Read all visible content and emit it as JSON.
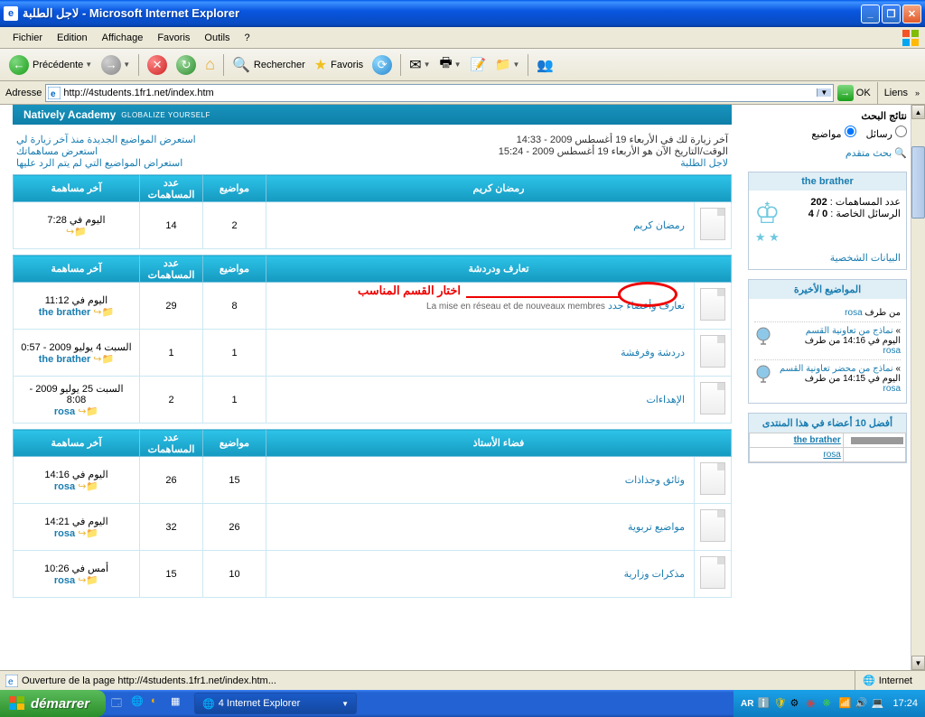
{
  "window": {
    "title": "لاجل الطلبة - Microsoft Internet Explorer"
  },
  "menu": {
    "file": "Fichier",
    "edit": "Edition",
    "view": "Affichage",
    "favorites": "Favoris",
    "tools": "Outils",
    "help": "?"
  },
  "toolbar": {
    "back": "Précédente",
    "search": "Rechercher",
    "favorites": "Favoris"
  },
  "address": {
    "label": "Adresse",
    "url": "http://4students.1fr1.net/index.htm",
    "ok": "OK",
    "links": "Liens"
  },
  "banner": {
    "brand": "Natively Academy",
    "tagline": "GLOBALIZE YOURSELF"
  },
  "page_info": {
    "right_line1": "آخر زيارة لك في الأربعاء 19 أغسطس 2009 - 14:33",
    "right_line2": "الوقت/التاريخ الآن هو الأربعاء 19 أغسطس 2009 - 15:24",
    "right_line3": "لاجل الطلبة",
    "left_line1": "استعرض المواضيع الجديدة منذ آخر زيارة لي",
    "left_line2": "استعرض مساهماتك",
    "left_line3": "استعراض المواضيع التي لم يتم الرد عليها"
  },
  "columns": {
    "last_post": "آخر مساهمة",
    "posts": "عدد المساهمات",
    "topics": "مواضيع"
  },
  "annotation": "اختار القسم المناسب",
  "sections": [
    {
      "header": "رمضان كريم",
      "forums": [
        {
          "icon": true,
          "title": "رمضان كريم",
          "desc": "",
          "topics": "2",
          "posts": "14",
          "last": "اليوم في 7:28",
          "last_user": "",
          "circled": true
        }
      ]
    },
    {
      "header": "تعارف ودردشة",
      "forums": [
        {
          "icon": true,
          "title": "تعارف وأعضاء جدد",
          "desc": "La mise en réseau et de nouveaux membres",
          "topics": "8",
          "posts": "29",
          "last": "اليوم في 11:12",
          "last_user": "the brather"
        },
        {
          "icon": true,
          "title": "دردشة وفرفشة",
          "desc": "",
          "topics": "1",
          "posts": "1",
          "last": "السبت 4 يوليو 2009 - 0:57",
          "last_user": "the brather"
        },
        {
          "icon": true,
          "title": "الإهداءات",
          "desc": "",
          "topics": "1",
          "posts": "2",
          "last": "السبت 25 يوليو 2009 - 8:08",
          "last_user": "rosa"
        }
      ]
    },
    {
      "header": "فضاء الأستاذ",
      "forums": [
        {
          "icon": true,
          "title": "وثائق وجذاذات",
          "desc": "",
          "topics": "15",
          "posts": "26",
          "last": "اليوم في 14:16",
          "last_user": "rosa"
        },
        {
          "icon": true,
          "title": "مواضيع تربوية",
          "desc": "",
          "topics": "26",
          "posts": "32",
          "last": "اليوم في 14:21",
          "last_user": "rosa"
        },
        {
          "icon": true,
          "title": "مذكرات وزارية",
          "desc": "",
          "topics": "10",
          "posts": "15",
          "last": "أمس في 10:26",
          "last_user": "rosa"
        }
      ]
    }
  ],
  "sidebar": {
    "search_title": "نتائج البحث",
    "opt_messages": "رسائل",
    "opt_topics": "مواضيع",
    "advanced_search": "بحث متقدم",
    "user_box_title": "the brather",
    "posts_label": "عدد المساهمات :",
    "posts_count": "202",
    "pm_label": "الرسائل الخاصة :",
    "pm_count": "0",
    "pm_divider": " / ",
    "pm_total": "4",
    "personal_data": "البيانات الشخصية",
    "recent_title": "المواضيع الأخيرة",
    "recent": [
      {
        "title_cut": "من طرف",
        "user": "rosa",
        "sep": "»",
        "topic": "نماذج من تعاونية القسم",
        "time": "اليوم في 14:16 من طرف",
        "by": "rosa"
      },
      {
        "sep": "»",
        "topic": "نماذج من محضر تعاونية القسم",
        "time": "اليوم في 14:15 من طرف",
        "by": "rosa"
      }
    ],
    "top_title": "أفضل 10 أعضاء في هذا المنتدى",
    "top_user": "the brather",
    "top_user2": "rosa"
  },
  "status": {
    "text": "Ouverture de la page http://4students.1fr1.net/index.htm...",
    "zone": "Internet"
  },
  "taskbar": {
    "start": "démarrer",
    "task1": "4 Internet Explorer",
    "lang": "AR",
    "clock": "17:24"
  }
}
